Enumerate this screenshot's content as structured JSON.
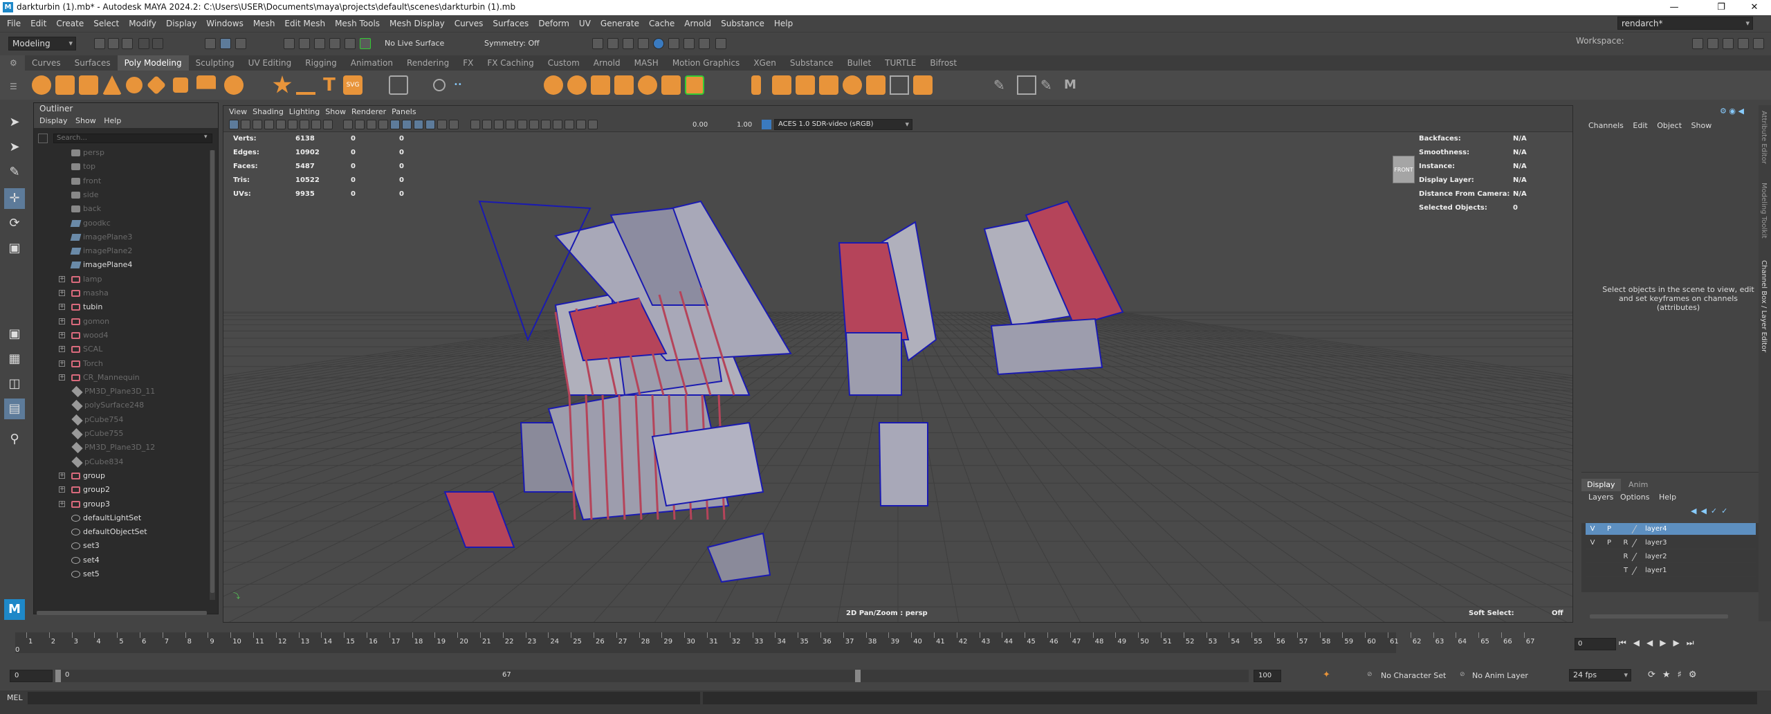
{
  "window": {
    "title": "darkturbin  (1).mb* - Autodesk MAYA 2024.2: C:\\Users\\USER\\Documents\\maya\\projects\\default\\scenes\\darkturbin  (1).mb",
    "app_icon": "M"
  },
  "menubar": [
    "File",
    "Edit",
    "Create",
    "Select",
    "Modify",
    "Display",
    "Windows",
    "Mesh",
    "Edit Mesh",
    "Mesh Tools",
    "Mesh Display",
    "Curves",
    "Surfaces",
    "Deform",
    "UV",
    "Generate",
    "Cache",
    "Arnold",
    "Substance",
    "Help"
  ],
  "workspace": {
    "label": "Workspace:",
    "value": "rendarch*"
  },
  "statusline": {
    "mode": "Modeling",
    "live_surface": "No Live Surface",
    "symmetry": "Symmetry: Off"
  },
  "shelf_tabs": [
    "Curves",
    "Surfaces",
    "Poly Modeling",
    "Sculpting",
    "UV Editing",
    "Rigging",
    "Animation",
    "Rendering",
    "FX",
    "FX Caching",
    "Custom",
    "Arnold",
    "MASH",
    "Motion Graphics",
    "XGen",
    "Substance",
    "Bullet",
    "TURTLE",
    "Bifrost"
  ],
  "shelf_active": "Poly Modeling",
  "outliner": {
    "title": "Outliner",
    "menu": [
      "Display",
      "Show",
      "Help"
    ],
    "search_placeholder": "Search...",
    "items": [
      {
        "name": "persp",
        "icon": "camera-icon",
        "dim": true,
        "expand": false
      },
      {
        "name": "top",
        "icon": "camera-icon",
        "dim": true,
        "expand": false
      },
      {
        "name": "front",
        "icon": "camera-icon",
        "dim": true,
        "expand": false
      },
      {
        "name": "side",
        "icon": "camera-icon",
        "dim": true,
        "expand": false
      },
      {
        "name": "back",
        "icon": "camera-icon",
        "dim": true,
        "expand": false
      },
      {
        "name": "goodkc",
        "icon": "image-plane-icon",
        "dim": true,
        "expand": false
      },
      {
        "name": "imagePlane3",
        "icon": "image-plane-icon",
        "dim": true,
        "expand": false
      },
      {
        "name": "imagePlane2",
        "icon": "image-plane-icon",
        "dim": true,
        "expand": false
      },
      {
        "name": "imagePlane4",
        "icon": "image-plane-icon",
        "dim": false,
        "expand": false
      },
      {
        "name": "lamp",
        "icon": "group-icon",
        "dim": true,
        "expand": true
      },
      {
        "name": "masha",
        "icon": "group-icon",
        "dim": true,
        "expand": true
      },
      {
        "name": "tubin",
        "icon": "group-icon",
        "dim": false,
        "expand": true
      },
      {
        "name": "gomon",
        "icon": "group-icon",
        "dim": true,
        "expand": true
      },
      {
        "name": "wood4",
        "icon": "group-icon",
        "dim": true,
        "expand": true
      },
      {
        "name": "SCAL",
        "icon": "group-icon",
        "dim": true,
        "expand": true
      },
      {
        "name": "Torch",
        "icon": "group-icon",
        "dim": true,
        "expand": true
      },
      {
        "name": "CR_Mannequin",
        "icon": "group-icon",
        "dim": true,
        "expand": true
      },
      {
        "name": "PM3D_Plane3D_11",
        "icon": "mesh-icon",
        "dim": true,
        "expand": false
      },
      {
        "name": "polySurface248",
        "icon": "mesh-icon",
        "dim": true,
        "expand": false
      },
      {
        "name": "pCube754",
        "icon": "mesh-icon",
        "dim": true,
        "expand": false
      },
      {
        "name": "pCube755",
        "icon": "mesh-icon",
        "dim": true,
        "expand": false
      },
      {
        "name": "PM3D_Plane3D_12",
        "icon": "mesh-icon",
        "dim": true,
        "expand": false
      },
      {
        "name": "pCube834",
        "icon": "mesh-icon",
        "dim": true,
        "expand": false
      },
      {
        "name": "group",
        "icon": "group-icon",
        "dim": false,
        "expand": true
      },
      {
        "name": "group2",
        "icon": "group-icon",
        "dim": false,
        "expand": true
      },
      {
        "name": "group3",
        "icon": "group-icon",
        "dim": false,
        "expand": true
      },
      {
        "name": "defaultLightSet",
        "icon": "set-icon",
        "dim": false,
        "expand": false
      },
      {
        "name": "defaultObjectSet",
        "icon": "set-icon",
        "dim": false,
        "expand": false
      },
      {
        "name": "set3",
        "icon": "set-icon",
        "dim": false,
        "expand": false
      },
      {
        "name": "set4",
        "icon": "set-icon",
        "dim": false,
        "expand": false
      },
      {
        "name": "set5",
        "icon": "set-icon",
        "dim": false,
        "expand": false
      }
    ]
  },
  "viewport": {
    "menu": [
      "View",
      "Shading",
      "Lighting",
      "Show",
      "Renderer",
      "Panels"
    ],
    "field_a": "0.00",
    "field_b": "1.00",
    "color_space": "ACES 1.0 SDR-video (sRGB)",
    "stats": [
      {
        "label": "Verts:",
        "a": "6138",
        "b": "0",
        "c": "0"
      },
      {
        "label": "Edges:",
        "a": "10902",
        "b": "0",
        "c": "0"
      },
      {
        "label": "Faces:",
        "a": "5487",
        "b": "0",
        "c": "0"
      },
      {
        "label": "Tris:",
        "a": "10522",
        "b": "0",
        "c": "0"
      },
      {
        "label": "UVs:",
        "a": "9935",
        "b": "0",
        "c": "0"
      }
    ],
    "right_hud": [
      {
        "label": "Backfaces:",
        "value": "N/A"
      },
      {
        "label": "Smoothness:",
        "value": "N/A"
      },
      {
        "label": "Instance:",
        "value": "N/A"
      },
      {
        "label": "Display Layer:",
        "value": "N/A"
      },
      {
        "label": "Distance From Camera:",
        "value": "N/A"
      },
      {
        "label": "Selected Objects:",
        "value": "0"
      }
    ],
    "view_cube_label": "FRONT",
    "footer": "2D Pan/Zoom : persp",
    "soft_select_label": "Soft Select:",
    "soft_select_value": "Off"
  },
  "channel_box": {
    "menu": [
      "Channels",
      "Edit",
      "Object",
      "Show"
    ],
    "message": "Select objects in the scene to view, edit and set keyframes on channels (attributes)"
  },
  "layer_editor": {
    "tabs": [
      "Display",
      "Anim"
    ],
    "menu": [
      "Layers",
      "Options",
      "Help"
    ],
    "layers": [
      {
        "v": "V",
        "p": "P",
        "r": "",
        "name": "layer4",
        "selected": true
      },
      {
        "v": "V",
        "p": "P",
        "r": "R",
        "name": "layer3",
        "selected": false
      },
      {
        "v": "",
        "p": "",
        "r": "R",
        "name": "layer2",
        "selected": false
      },
      {
        "v": "",
        "p": "",
        "r": "T",
        "name": "layer1",
        "selected": false
      }
    ]
  },
  "side_tabs": [
    "Attribute Editor",
    "Modeling Toolkit",
    "Channel Box / Layer Editor"
  ],
  "timeline": {
    "ticks": [
      "1",
      "2",
      "3",
      "4",
      "5",
      "6",
      "7",
      "8",
      "9",
      "10",
      "11",
      "12",
      "13",
      "14",
      "15",
      "16",
      "17",
      "18",
      "19",
      "20",
      "21",
      "22",
      "23",
      "24",
      "25",
      "26",
      "27",
      "28",
      "29",
      "30",
      "31",
      "32",
      "33",
      "34",
      "35",
      "36",
      "37",
      "38",
      "39",
      "40",
      "41",
      "42",
      "43",
      "44",
      "45",
      "46",
      "47",
      "48",
      "49",
      "50",
      "51",
      "52",
      "53",
      "54",
      "55",
      "56",
      "57",
      "58",
      "59",
      "60",
      "61",
      "62",
      "63",
      "64",
      "65",
      "66",
      "67"
    ],
    "start_zero": "0",
    "current_frame": "0"
  },
  "range": {
    "start": "0",
    "inner_start": "0",
    "inner_end": "67",
    "end": "100",
    "character_set": "No Character Set",
    "anim_layer": "No Anim Layer",
    "fps": "24 fps"
  },
  "cmdline": {
    "label": "MEL"
  },
  "colors": {
    "selection_blue": "#5d8fc0",
    "shelf_orange": "#e8943a",
    "wire_red": "#b5445a",
    "wire_blue": "#1a1ab0"
  }
}
